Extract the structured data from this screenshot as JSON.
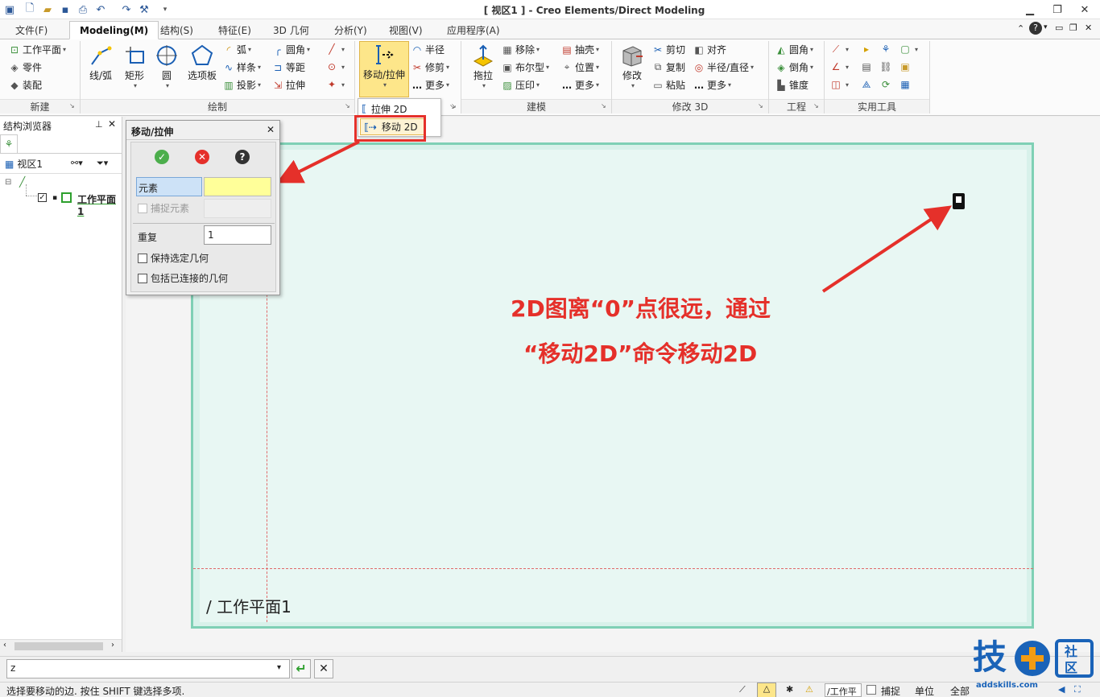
{
  "app": {
    "title": "[ 视区1 ] - Creo Elements/Direct Modeling"
  },
  "tabs": [
    {
      "label": "文件(F)"
    },
    {
      "label": "Modeling(M)"
    },
    {
      "label": "结构(S)"
    },
    {
      "label": "特征(E)"
    },
    {
      "label": "3D 几何"
    },
    {
      "label": "分析(Y)"
    },
    {
      "label": "视图(V)"
    },
    {
      "label": "应用程序(A)"
    }
  ],
  "ribbon": {
    "new_group": {
      "items": [
        "工作平面",
        "零件",
        "装配"
      ],
      "label": "新建"
    },
    "draw_group": {
      "big": [
        "线/弧",
        "矩形",
        "圆",
        "选项板"
      ],
      "small_col1": [
        "弧",
        "样条",
        "投影"
      ],
      "small_col2": [
        "圆角",
        "等距",
        "拉伸"
      ],
      "label": "绘制"
    },
    "move_group": {
      "big": "移动/拉伸",
      "small": [
        "半径",
        "修剪",
        "更多"
      ]
    },
    "dropdown": {
      "items": [
        "拉伸 2D",
        "移动 2D"
      ]
    },
    "model_group": {
      "big": "拖拉",
      "col1": [
        "移除",
        "布尔型",
        "压印"
      ],
      "col2": [
        "抽壳",
        "位置",
        "更多"
      ],
      "label": "建模"
    },
    "modify3d_group": {
      "big": "修改",
      "col1": [
        "剪切",
        "复制",
        "粘贴"
      ],
      "col2": [
        "对齐",
        "半径/直径",
        "更多"
      ],
      "label": "修改 3D"
    },
    "eng_group": {
      "items": [
        "圆角",
        "倒角",
        "锥度"
      ],
      "label": "工程"
    },
    "tools_group": {
      "label": "实用工具"
    }
  },
  "browser": {
    "title": "结构浏览器",
    "viewport_label": "视区1",
    "workplane_item": "工作平面1"
  },
  "dialog": {
    "title": "移动/拉伸",
    "element_label": "元素",
    "capture_label": "捕捉元素",
    "repeat_label": "重复",
    "repeat_value": "1",
    "keep_label": "保持选定几何",
    "include_label": "包括已连接的几何"
  },
  "canvas": {
    "workplane_text": "/ 工作平面1"
  },
  "annotation": {
    "line1": "2D图离“0”点很远，通过",
    "line2": "“移动2D”命令移动2D"
  },
  "cmd": {
    "input_value": "z"
  },
  "status": {
    "prompt": "选择要移动的边. 按住 SHIFT 键选择多项.",
    "wp_field": "/工作平",
    "capture": "捕捉",
    "unit": "单位",
    "all": "全部"
  },
  "logo": {
    "char1": "技",
    "char2": "社",
    "char3": "区",
    "domain": "addskills.com"
  },
  "colors": {
    "accent": "#e5302a",
    "plane": "#d8f1ea",
    "plane_border": "#7fd0b5",
    "highlight": "#fde68a"
  }
}
